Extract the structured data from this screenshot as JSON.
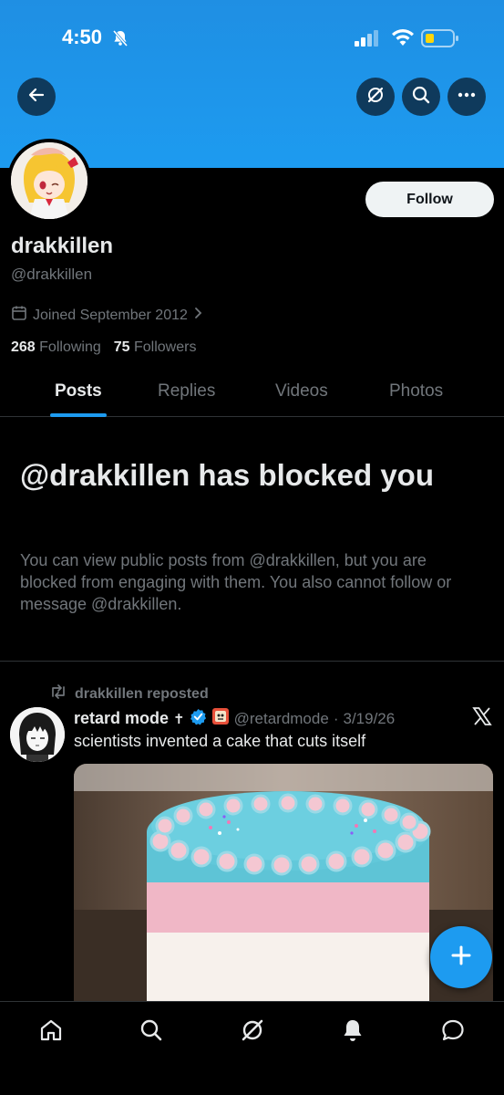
{
  "status_bar": {
    "time": "4:50"
  },
  "profile": {
    "display_name": "drakkillen",
    "handle": "@drakkillen",
    "joined": "Joined September 2012",
    "following_count": "268",
    "following_label": "Following",
    "followers_count": "75",
    "followers_label": "Followers",
    "follow_label": "Follow"
  },
  "tabs": [
    {
      "label": "Posts",
      "active": true
    },
    {
      "label": "Replies",
      "active": false
    },
    {
      "label": "Videos",
      "active": false
    },
    {
      "label": "Photos",
      "active": false
    }
  ],
  "blocked": {
    "title": "@drakkillen has blocked you",
    "body": "You can view public posts from @drakkillen, but you are blocked from engaging with them. You also cannot follow or message @drakkillen."
  },
  "post": {
    "repost_label": "drakkillen reposted",
    "author_name": "retard mode",
    "author_handle": "@retardmode",
    "separator": "·",
    "date": "3/19/26",
    "text": "scientists invented a cake that cuts itself"
  },
  "icons": {
    "back": "back-arrow-icon",
    "grok": "grok-icon",
    "search": "search-icon",
    "more": "more-icon",
    "calendar": "calendar-icon",
    "repost": "repost-icon",
    "verified": "verified-badge-icon",
    "x": "x-logo-icon",
    "compose": "plus-icon",
    "nav": [
      "home-icon",
      "search-icon",
      "grok-icon",
      "bell-icon",
      "messages-icon"
    ]
  },
  "colors": {
    "accent": "#1d9bf0",
    "background": "#000000",
    "muted_text": "#71767b",
    "primary_text": "#e7e9ea"
  }
}
